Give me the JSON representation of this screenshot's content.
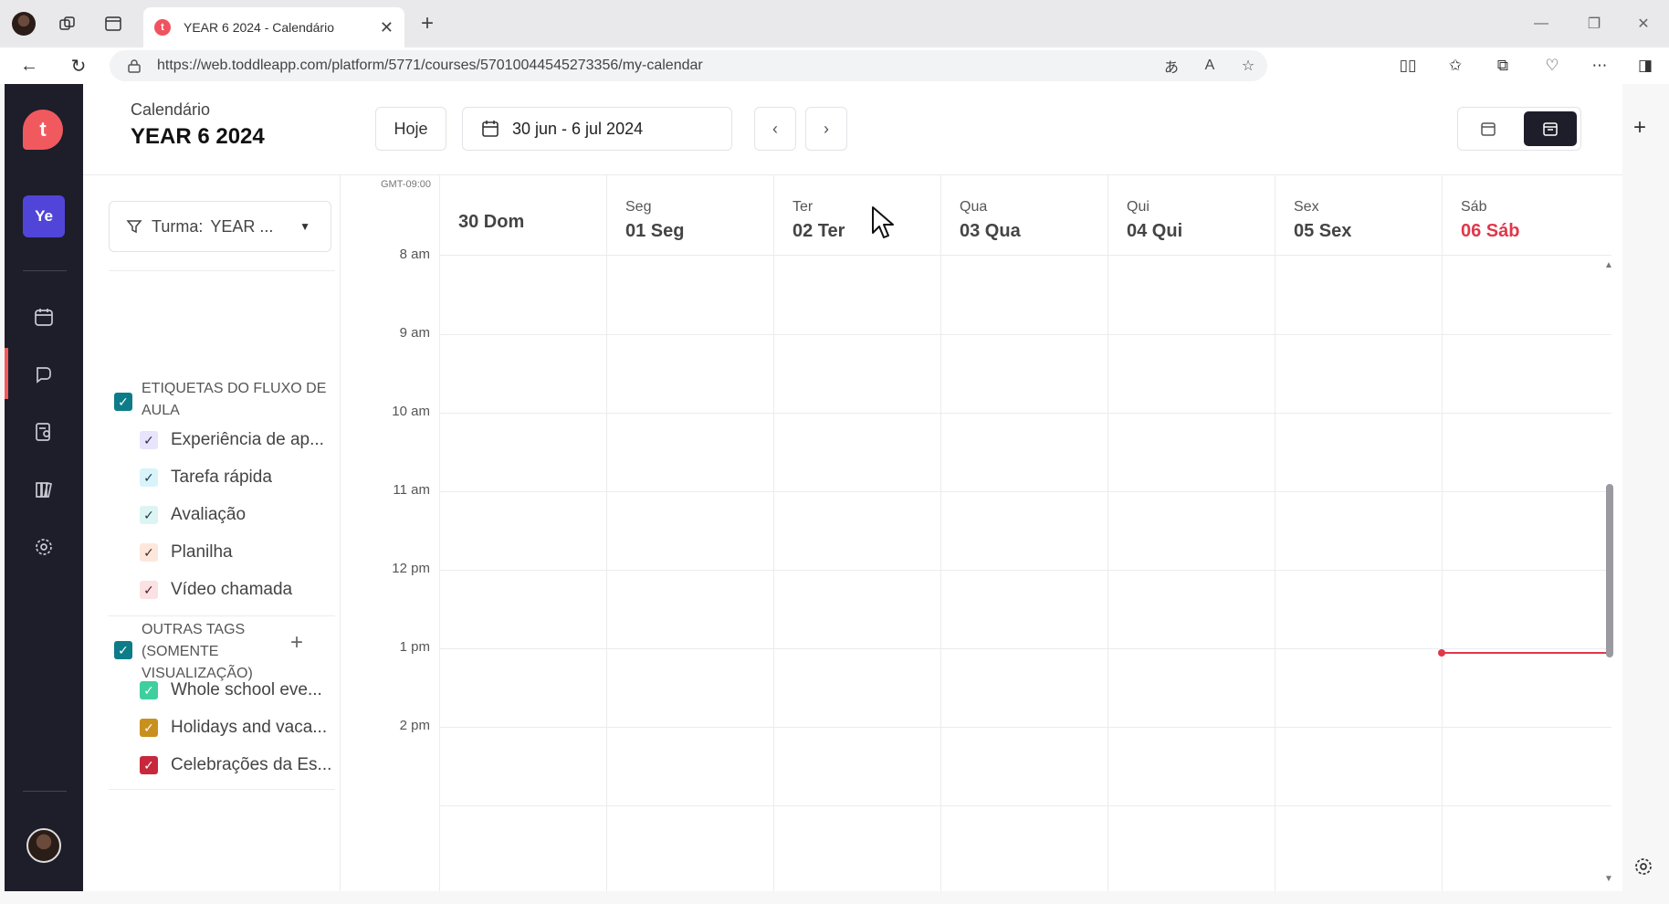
{
  "browser": {
    "tab_title": "YEAR 6 2024 - Calendário",
    "url": "https://web.toddleapp.com/platform/5771/courses/57010044545273356/my-calendar"
  },
  "rail": {
    "logo_letter": "t",
    "course_badge": "Ye"
  },
  "header": {
    "subtitle": "Calendário",
    "title": "YEAR 6 2024",
    "today_label": "Hoje",
    "date_range": "30 jun - 6 jul 2024"
  },
  "filters": {
    "turma_label": "Turma:",
    "turma_value": "YEAR ...",
    "group1_label": "ETIQUETAS DO FLUXO DE AULA",
    "group1_items": [
      {
        "label": "Experiência de ap...",
        "color": "#e8e4fb"
      },
      {
        "label": "Tarefa rápida",
        "color": "#d9f3fa"
      },
      {
        "label": "Avaliação",
        "color": "#dcf5f2"
      },
      {
        "label": "Planilha",
        "color": "#fde7dc"
      },
      {
        "label": "Vídeo chamada",
        "color": "#fbe1e3"
      }
    ],
    "group2_label": "OUTRAS TAGS (SOMENTE VISUALIZAÇÃO)",
    "group2_items": [
      {
        "label": "Whole school eve...",
        "color": "#3ecf9f"
      },
      {
        "label": "Holidays and vaca...",
        "color": "#c9901e"
      },
      {
        "label": "Celebrações da Es...",
        "color": "#c8283c"
      }
    ]
  },
  "calendar": {
    "timezone": "GMT-09:00",
    "days": [
      {
        "name": "",
        "num": "30 Dom"
      },
      {
        "name": "Seg",
        "num": "01 Seg"
      },
      {
        "name": "Ter",
        "num": "02 Ter"
      },
      {
        "name": "Qua",
        "num": "03 Qua"
      },
      {
        "name": "Qui",
        "num": "04 Qui"
      },
      {
        "name": "Sex",
        "num": "05 Sex"
      },
      {
        "name": "Sáb",
        "num": "06 Sáb"
      }
    ],
    "times": [
      "8 am",
      "9 am",
      "10 am",
      "11 am",
      "12 pm",
      "1 pm",
      "2 pm"
    ],
    "today_color": "#e0374a"
  }
}
